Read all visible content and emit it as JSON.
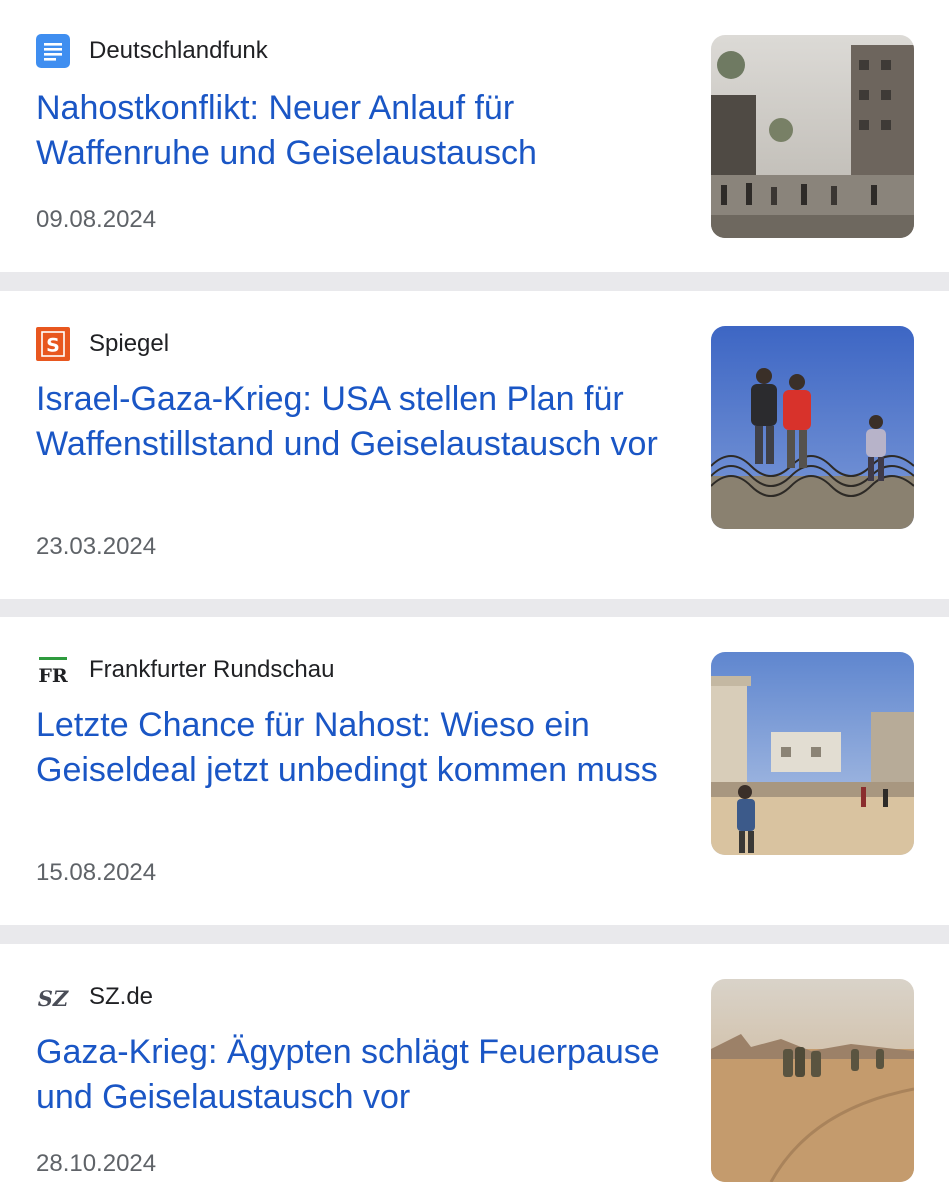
{
  "articles": [
    {
      "source": "Deutschlandfunk",
      "source_icon": "document-icon",
      "title": "Nahostkonflikt: Neuer Anlauf für Waffenruhe und Geiselaustausch",
      "date": "09.08.2024",
      "image": "gaza-street-ruins-image"
    },
    {
      "source": "Spiegel",
      "source_icon": "spiegel-s-logo",
      "title": "Israel-Gaza-Krieg: USA stellen Plan für Waffenstillstand und Geiselaustausch vor",
      "date": "23.03.2024",
      "image": "people-at-barbed-wire-image"
    },
    {
      "source": "Frankfurter Rundschau",
      "source_icon": "fr-logo",
      "logo_text": "FR",
      "title": "Letzte Chance für Nahost: Wieso ein Geiseldeal jetzt unbedingt kommen muss",
      "date": "15.08.2024",
      "image": "desert-ruins-people-walking-image"
    },
    {
      "source": "SZ.de",
      "source_icon": "sz-logo",
      "logo_text": "SZ",
      "title": "Gaza-Krieg: Ägypten schlägt Feuerpause und Geiselaustausch vor",
      "date": "28.10.2024",
      "image": "soldiers-walking-sand-image"
    }
  ],
  "colors": {
    "title_link": "#1a56c5",
    "source_text": "#202124",
    "date_text": "#5f6368",
    "divider": "#e9e9ec",
    "deutschlandfunk_icon": "#3f8ef0",
    "spiegel_logo": "#e8571f",
    "fr_logo_bar": "#2e9b3e"
  }
}
